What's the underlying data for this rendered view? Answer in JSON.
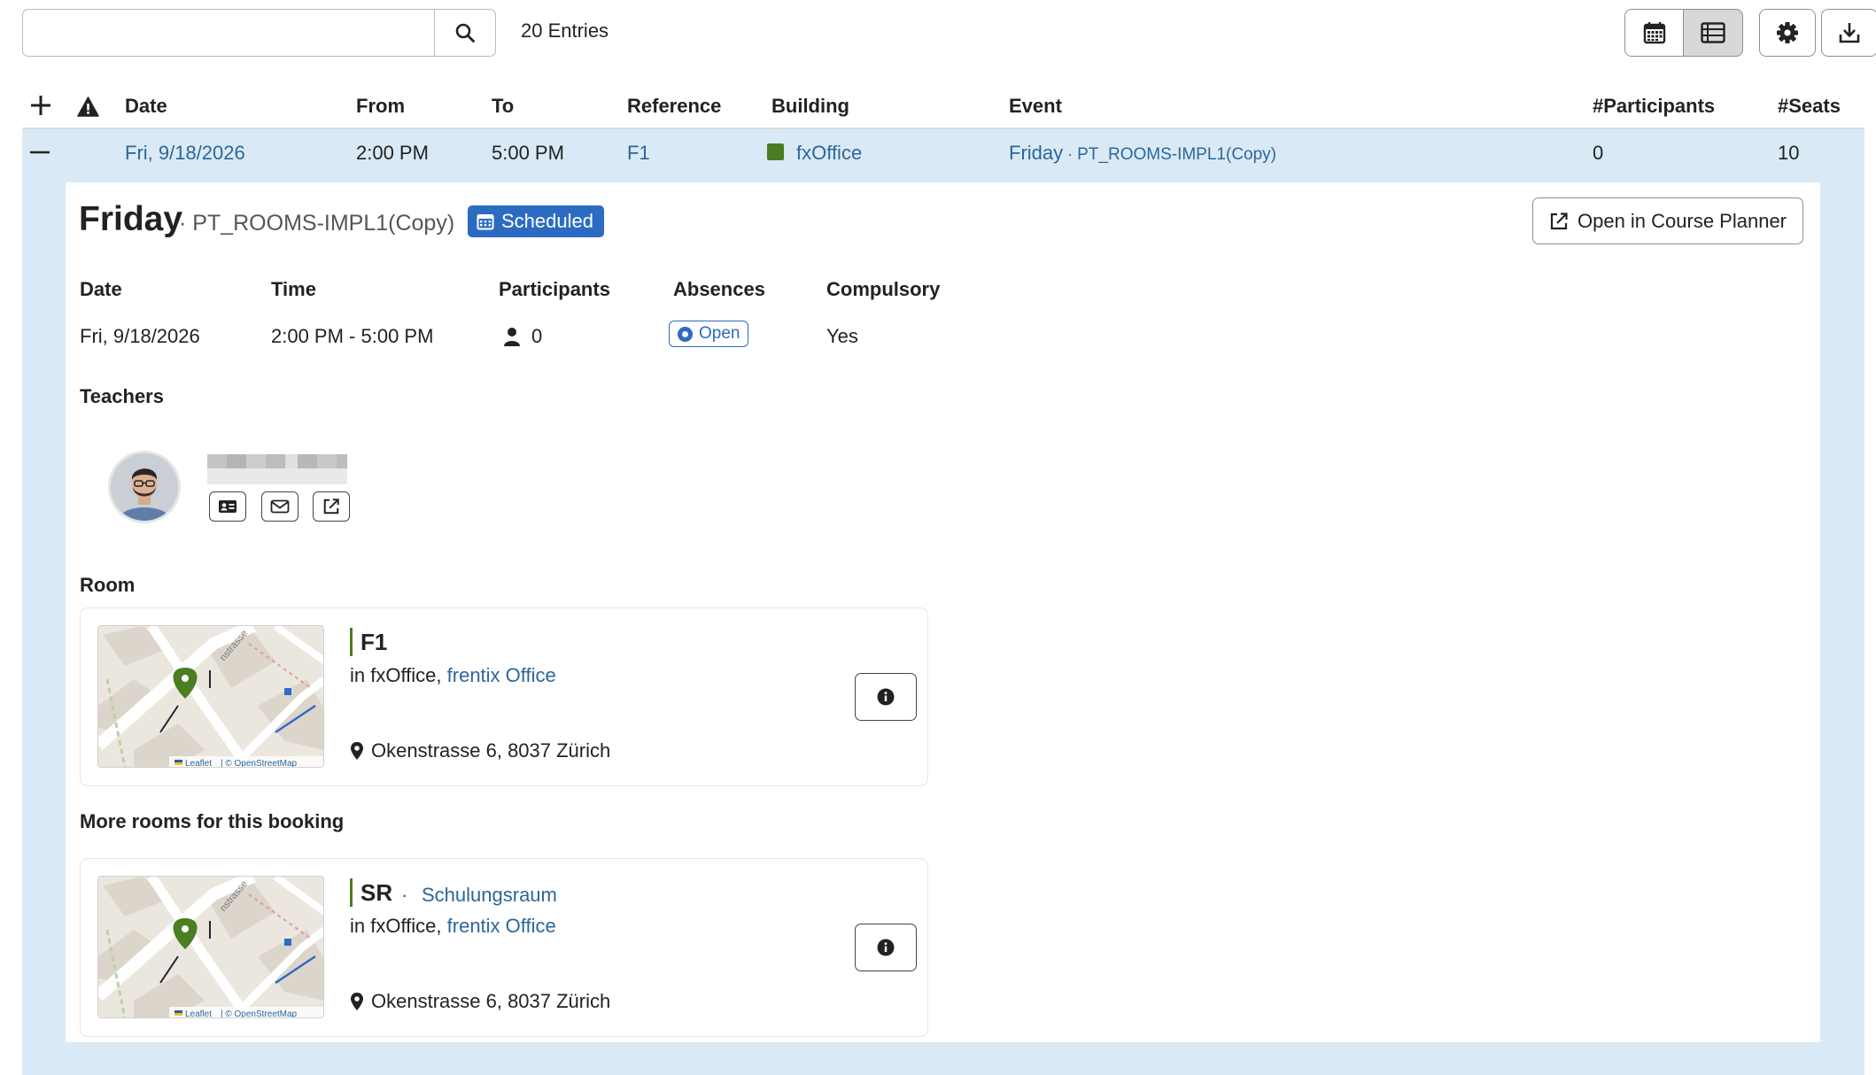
{
  "toolbar": {
    "search_value": "",
    "entries_label": "20 Entries"
  },
  "table": {
    "headers": [
      "Date",
      "From",
      "To",
      "Reference",
      "Building",
      "Event",
      "#Participants",
      "#Seats"
    ],
    "row": {
      "date": "Fri, 9/18/2026",
      "from": "2:00 PM",
      "to": "5:00 PM",
      "reference": "F1",
      "building": "fxOffice",
      "event_name": "Friday",
      "event_sep": " · ",
      "event_code": "PT_ROOMS-IMPL1(Copy)",
      "participants": "0",
      "seats": "10"
    }
  },
  "detail": {
    "title": "Friday",
    "subtitle": "· PT_ROOMS-IMPL1(Copy)",
    "status_badge": "Scheduled",
    "open_planner": "Open in Course Planner",
    "labels": {
      "date": "Date",
      "time": "Time",
      "participants": "Participants",
      "absences": "Absences",
      "compulsory": "Compulsory"
    },
    "values": {
      "date": "Fri, 9/18/2026",
      "time": "2:00 PM - 5:00 PM",
      "participants": "0",
      "absences": "Open",
      "compulsory": "Yes"
    },
    "teachers_label": "Teachers",
    "room_label": "Room",
    "more_rooms_label": "More rooms for this booking",
    "rooms": [
      {
        "name": "F1",
        "subname": "",
        "in_prefix": "in fxOffice, ",
        "in_link": "frentix Office",
        "address": "Okenstrasse 6, 8037 Zürich",
        "attribution_leaflet": "Leaflet",
        "attribution_osm": "| © OpenStreetMap"
      },
      {
        "name": "SR",
        "subname": "Schulungsraum",
        "in_prefix": "in fxOffice, ",
        "in_link": "frentix Office",
        "address": "Okenstrasse 6, 8037 Zürich",
        "attribution_leaflet": "Leaflet",
        "attribution_osm": "| © OpenStreetMap"
      }
    ]
  },
  "colors": {
    "accent_blue": "#2c6bc1",
    "link_blue": "#2d6699",
    "row_highlight": "#d9eaf6",
    "building_green": "#4b7d22"
  },
  "icons": {
    "search": "search-icon",
    "calendar_view": "calendar-icon",
    "list_view": "list-icon",
    "settings": "gear-icon",
    "download": "download-icon",
    "add": "plus-icon",
    "warning": "warning-icon",
    "collapse": "minus-icon",
    "external": "external-link-icon",
    "person": "person-icon",
    "vcard": "vcard-icon",
    "mail": "mail-icon",
    "info": "info-icon",
    "pin": "map-pin-icon"
  }
}
